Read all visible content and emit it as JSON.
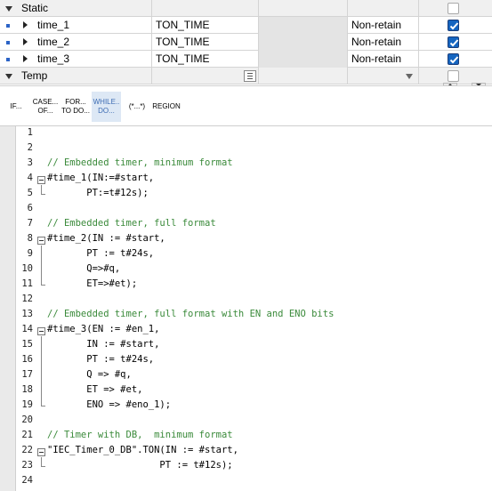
{
  "interface": {
    "static_section": {
      "label": "Static",
      "retain_checked": false
    },
    "rows": [
      {
        "name": "time_1",
        "type": "TON_TIME",
        "retain": "Non-retain",
        "checked": true
      },
      {
        "name": "time_2",
        "type": "TON_TIME",
        "retain": "Non-retain",
        "checked": true
      },
      {
        "name": "time_3",
        "type": "TON_TIME",
        "retain": "Non-retain",
        "checked": true
      }
    ],
    "temp_section": {
      "label": "Temp",
      "retain_checked": false
    }
  },
  "toolbar": {
    "buttons": [
      {
        "line1": "IF...",
        "line2": ""
      },
      {
        "line1": "CASE...",
        "line2": "OF..."
      },
      {
        "line1": "FOR...",
        "line2": "TO DO..."
      },
      {
        "line1": "WHILE..",
        "line2": "DO..."
      },
      {
        "line1": "(*...*)",
        "line2": ""
      },
      {
        "line1": "REGION",
        "line2": ""
      }
    ]
  },
  "code": {
    "lines": [
      {
        "n": "1",
        "text": ""
      },
      {
        "n": "2",
        "text": ""
      },
      {
        "n": "3",
        "text": "// Embedded timer, minimum format",
        "kind": "comment"
      },
      {
        "n": "4",
        "text": "#time_1(IN:=#start,"
      },
      {
        "n": "5",
        "text": "       PT:=t#12s);"
      },
      {
        "n": "6",
        "text": ""
      },
      {
        "n": "7",
        "text": "// Embedded timer, full format",
        "kind": "comment"
      },
      {
        "n": "8",
        "text": "#time_2(IN := #start,"
      },
      {
        "n": "9",
        "text": "       PT := t#24s,"
      },
      {
        "n": "10",
        "text": "       Q=>#q,"
      },
      {
        "n": "11",
        "text": "       ET=>#et);"
      },
      {
        "n": "12",
        "text": ""
      },
      {
        "n": "13",
        "text": "// Embedded timer, full format with EN and ENO bits",
        "kind": "comment"
      },
      {
        "n": "14",
        "text": "#time_3(EN := #en_1,"
      },
      {
        "n": "15",
        "text": "       IN := #start,"
      },
      {
        "n": "16",
        "text": "       PT := t#24s,"
      },
      {
        "n": "17",
        "text": "       Q => #q,"
      },
      {
        "n": "18",
        "text": "       ET => #et,"
      },
      {
        "n": "19",
        "text": "       ENO => #eno_1);"
      },
      {
        "n": "20",
        "text": ""
      },
      {
        "n": "21",
        "text": "// Timer with DB,  minimum format",
        "kind": "comment"
      },
      {
        "n": "22",
        "text": "\"IEC_Timer_0_DB\".TON(IN := #start,"
      },
      {
        "n": "23",
        "text": "                    PT := t#12s);"
      },
      {
        "n": "24",
        "text": ""
      }
    ]
  }
}
